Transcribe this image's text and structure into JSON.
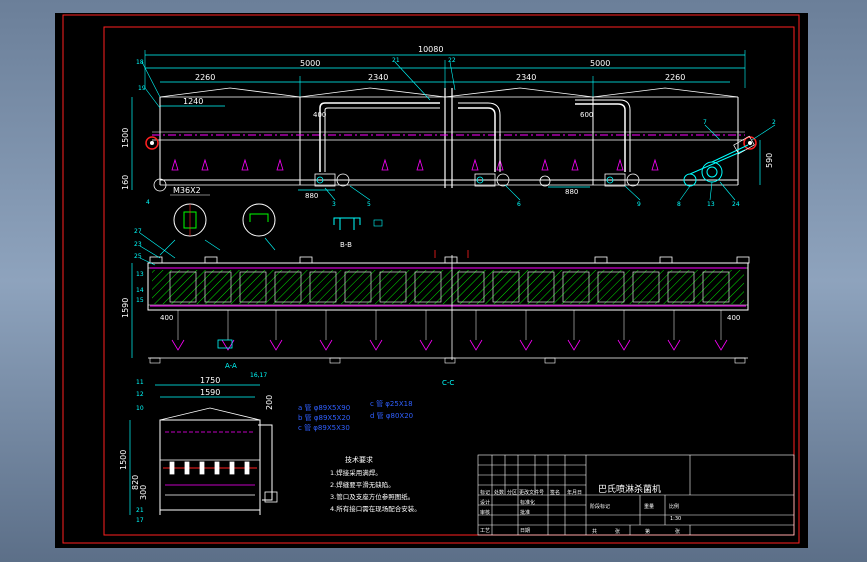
{
  "overall_dimension": "10080",
  "top_dims": [
    "5000",
    "5000"
  ],
  "segment_dims": [
    "2260",
    "2340",
    "2340",
    "2260"
  ],
  "sub_dims": {
    "d1240": "1240",
    "d400": "400",
    "d600": "600",
    "d880a": "880",
    "d880b": "880"
  },
  "left_dims": {
    "h1500": "1500",
    "h160": "160",
    "h590": "590"
  },
  "thread_label": "M36X2",
  "section_label": "B-B",
  "plan_dims": {
    "w400a": "400",
    "w400b": "400",
    "h1590": "1590"
  },
  "bottom_marks": {
    "ck": "C-C",
    "a": "A-A"
  },
  "end_view_dims": {
    "w1750": "1750",
    "w1590": "1590",
    "h200": "200",
    "h1500": "1500",
    "h820": "820",
    "h300": "300"
  },
  "bom_lines": {
    "a": "a 管 φ89X5X90",
    "b": "b 管 φ89X5X20",
    "c": "c 管 φ89X5X30",
    "d": "c 管 φ25X18",
    "e": "d 管 φ80X20"
  },
  "tech_requirements": {
    "title": "技术要求",
    "items": [
      "1.焊接采用满焊。",
      "2.焊缝要平滑无缺陷。",
      "3.管口及支座方位参照图纸。",
      "4.所有接口需在现场配合安装。"
    ]
  },
  "title_block": {
    "drawing_name": "巴氏喷淋杀菌机",
    "header_cells": [
      "标记",
      "处数",
      "分区",
      "更改文件号",
      "签名",
      "年月日"
    ],
    "role_labels": [
      "设计",
      "审核",
      "工艺",
      "标准化",
      "批准",
      "日期"
    ],
    "mark_labels": [
      "阶段标记",
      "重量",
      "比例"
    ],
    "scale": "1:30",
    "sheet_labels": [
      "共",
      "张",
      "第",
      "张"
    ]
  },
  "colors": {
    "frame": "#ff2020",
    "line": "#ffffff",
    "dim": "#00ffff",
    "green": "#00ff00",
    "magenta": "#ff00ff",
    "blue": "#3060ff",
    "yellow": "#ffff00",
    "cyan": "#00ffff"
  }
}
